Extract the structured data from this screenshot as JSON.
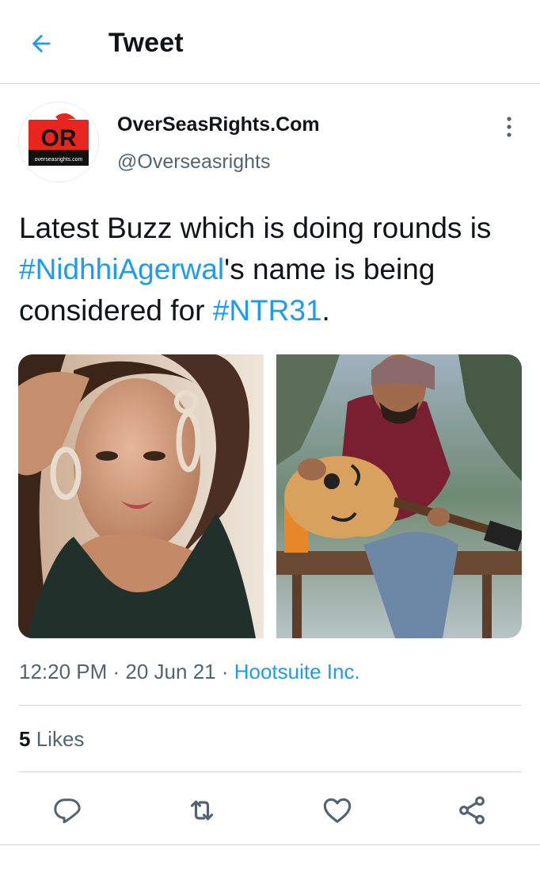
{
  "header": {
    "title": "Tweet",
    "back_icon": "arrow-left-icon"
  },
  "tweet": {
    "author": {
      "name": "OverSeasRights.Com",
      "handle": "@Overseasrights",
      "avatar_logo_text": "OR",
      "avatar_logo_subtext": "overseasrights.com"
    },
    "text_parts": [
      {
        "text": "Latest Buzz which is doing rounds is   ",
        "hashtag": false
      },
      {
        "text": "#NidhhiAgerwal",
        "hashtag": true
      },
      {
        "text": "'s name is being  considered for ",
        "hashtag": false
      },
      {
        "text": "#NTR31",
        "hashtag": true
      },
      {
        "text": ".",
        "hashtag": false
      }
    ],
    "meta": {
      "time": "12:20 PM",
      "separator": " · ",
      "date": "20 Jun 21",
      "source_separator": " · ",
      "source": "Hootsuite Inc."
    },
    "likes": {
      "count": "5",
      "label": "Likes"
    }
  },
  "actions": [
    {
      "name": "reply",
      "icon": "reply-icon"
    },
    {
      "name": "retweet",
      "icon": "retweet-icon"
    },
    {
      "name": "like",
      "icon": "heart-icon"
    },
    {
      "name": "share",
      "icon": "share-icon"
    }
  ],
  "colors": {
    "accent": "#1d9bf0",
    "text_primary": "#0f1419",
    "text_secondary": "#536471",
    "divider": "#cfd9de",
    "logo_red": "#e8251f"
  }
}
